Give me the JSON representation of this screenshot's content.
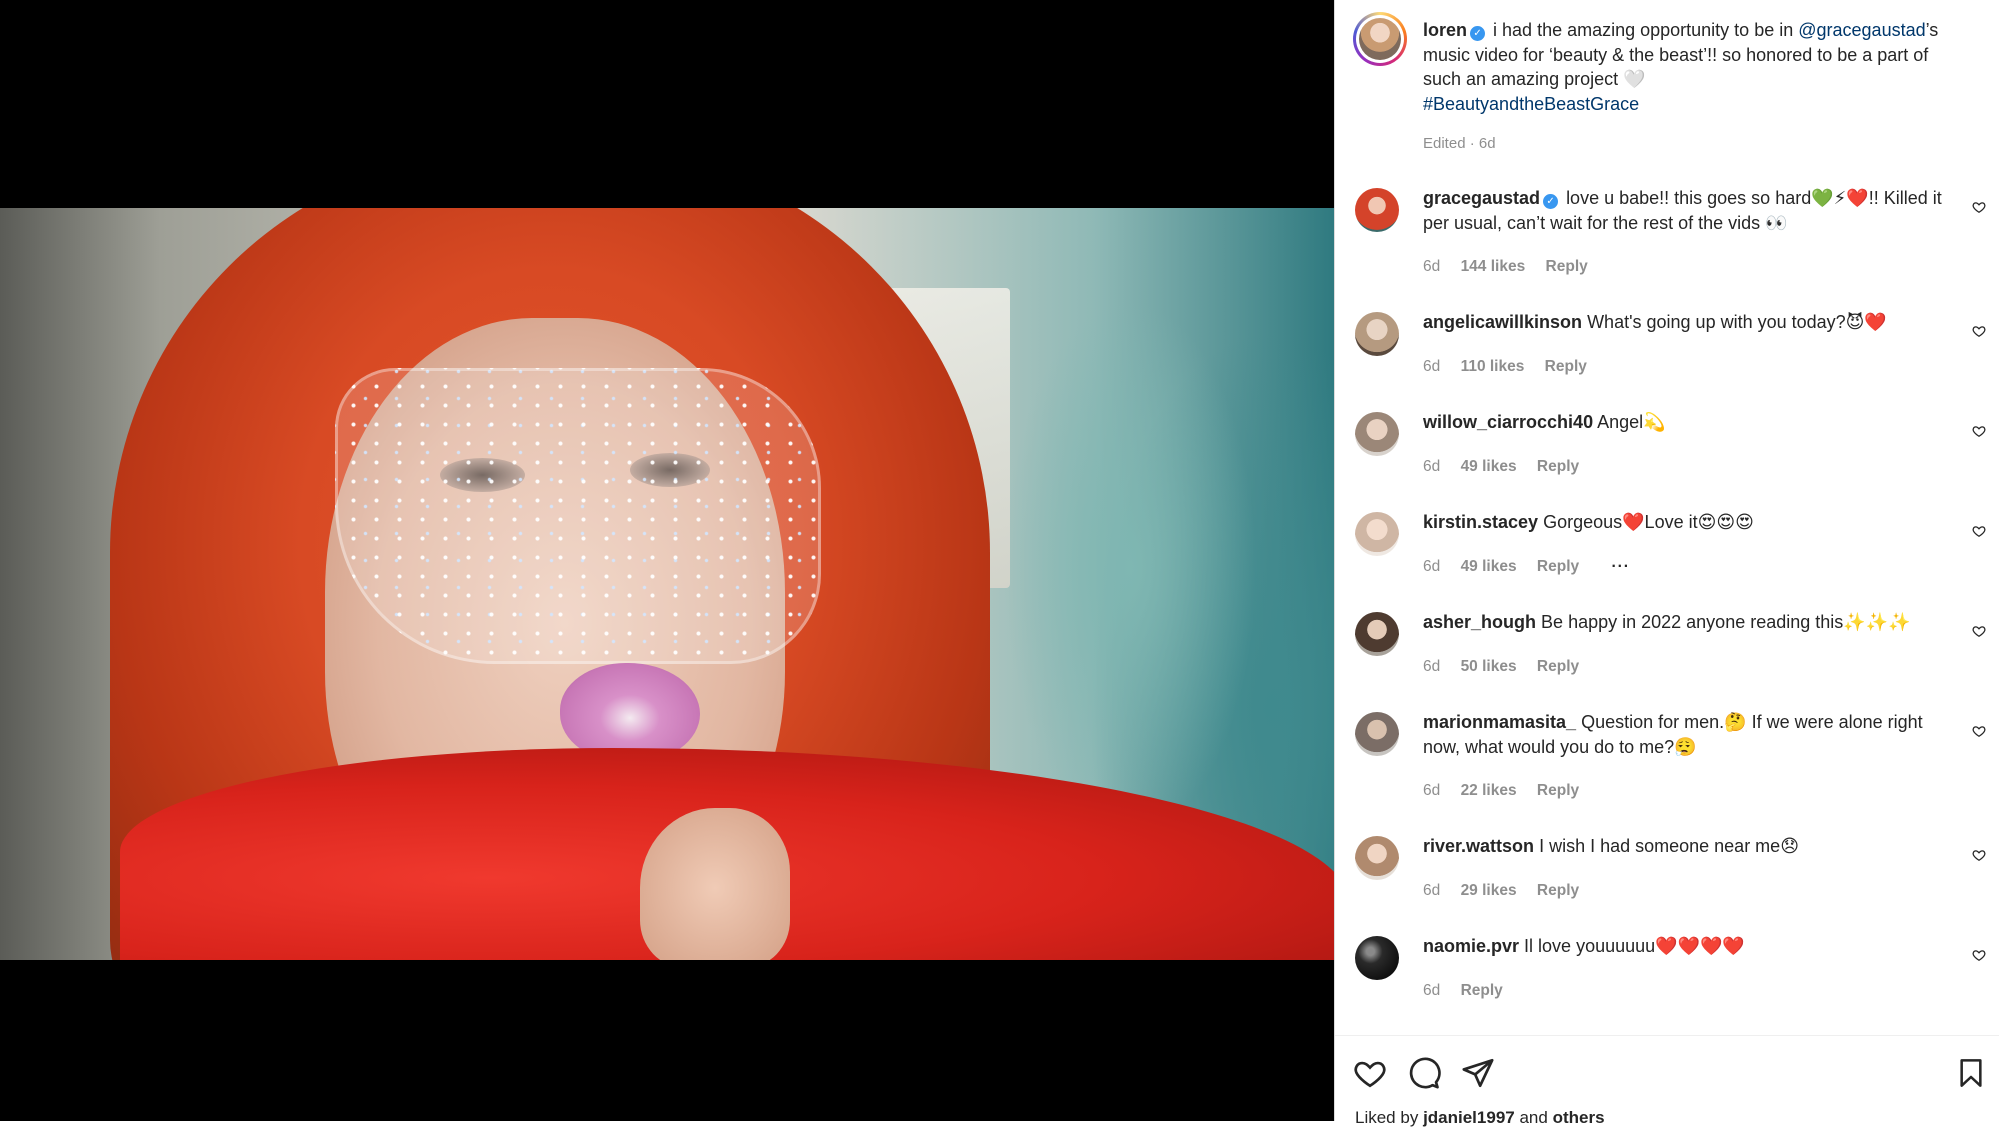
{
  "post": {
    "author": "loren",
    "caption_before_mention": "i had the amazing opportunity to be in",
    "mention": "@gracegaustad",
    "caption_after_mention": "’s music video for ‘beauty & the beast’!! so honored to be a part of such an amazing project 🤍",
    "hashtag": "#BeautyandtheBeastGrace",
    "meta": "Edited · 6d"
  },
  "comments": [
    {
      "user": "gracegaustad",
      "verified": true,
      "text": "love u babe!! this goes so hard💚⚡❤️!! Killed it per usual, can’t wait for the rest of the vids 👀",
      "time": "6d",
      "likes": "144 likes",
      "reply": "Reply"
    },
    {
      "user": "angelicawillkinson",
      "text": "What's going up with you today?😈❤️",
      "time": "6d",
      "likes": "110 likes",
      "reply": "Reply"
    },
    {
      "user": "willow_ciarrocchi40",
      "text": "Angel💫",
      "time": "6d",
      "likes": "49 likes",
      "reply": "Reply"
    },
    {
      "user": "kirstin.stacey",
      "text": "Gorgeous❤️Love it😍😍😍",
      "time": "6d",
      "likes": "49 likes",
      "reply": "Reply",
      "more": "···"
    },
    {
      "user": "asher_hough",
      "text": "Be happy in 2022 anyone reading this✨✨✨",
      "time": "6d",
      "likes": "50 likes",
      "reply": "Reply"
    },
    {
      "user": "marionmamasita_",
      "text": "Question for men.🤔 If we were alone right now, what would you do to me?😮‍💨",
      "time": "6d",
      "likes": "22 likes",
      "reply": "Reply"
    },
    {
      "user": "river.wattson",
      "text": "I wish I had someone near me😞",
      "time": "6d",
      "likes": "29 likes",
      "reply": "Reply"
    },
    {
      "user": "naomie.pvr",
      "text": "Il love youuuuuu❤️❤️❤️❤️",
      "time": "6d",
      "reply": "Reply"
    }
  ],
  "footer": {
    "liked_by_prefix": "Liked by",
    "liked_by_user": "jdaniel1997",
    "liked_by_and": "and",
    "liked_by_others": "others"
  },
  "icons": {
    "like": "heart-icon",
    "comment": "comment-icon",
    "share": "paper-plane-icon",
    "save": "bookmark-icon"
  },
  "colors": {
    "link": "#00376b",
    "verified": "#3897f0",
    "muted": "#8e8e8e"
  }
}
